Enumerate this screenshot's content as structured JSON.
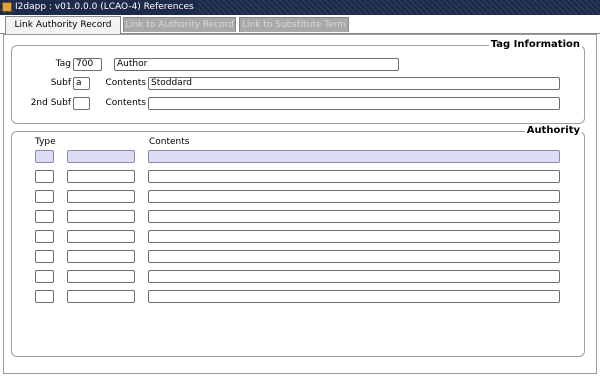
{
  "window": {
    "title": "I2dapp : v01.0.0.0 (LCAO-4) References"
  },
  "tabs": [
    {
      "label": "Link Authority Record",
      "active": true
    },
    {
      "label": "Link to Authority Record",
      "active": false
    },
    {
      "label": "Link to Substitute Term",
      "active": false
    }
  ],
  "tag_info": {
    "title": "Tag Information",
    "tag_label": "Tag",
    "tag_value": "700",
    "tag_desc": "Author",
    "subf_label": "Subf",
    "subf_value": "a",
    "contents_label": "Contents",
    "contents_value": "Stoddard",
    "subf2_label": "2nd Subf",
    "subf2_value": "",
    "contents2_label": "Contents",
    "contents2_value": ""
  },
  "authority": {
    "title": "Authority",
    "headers": {
      "type": "Type",
      "contents": "Contents"
    },
    "rows": [
      {
        "type": "",
        "code": "",
        "contents": ""
      },
      {
        "type": "",
        "code": "",
        "contents": ""
      },
      {
        "type": "",
        "code": "",
        "contents": ""
      },
      {
        "type": "",
        "code": "",
        "contents": ""
      },
      {
        "type": "",
        "code": "",
        "contents": ""
      },
      {
        "type": "",
        "code": "",
        "contents": ""
      },
      {
        "type": "",
        "code": "",
        "contents": ""
      },
      {
        "type": "",
        "code": "",
        "contents": ""
      }
    ]
  },
  "colors": {
    "titlebar": "#1c2b4a",
    "highlight_row": "#dcdcf5",
    "inactive_tab": "#a9a9a9"
  }
}
